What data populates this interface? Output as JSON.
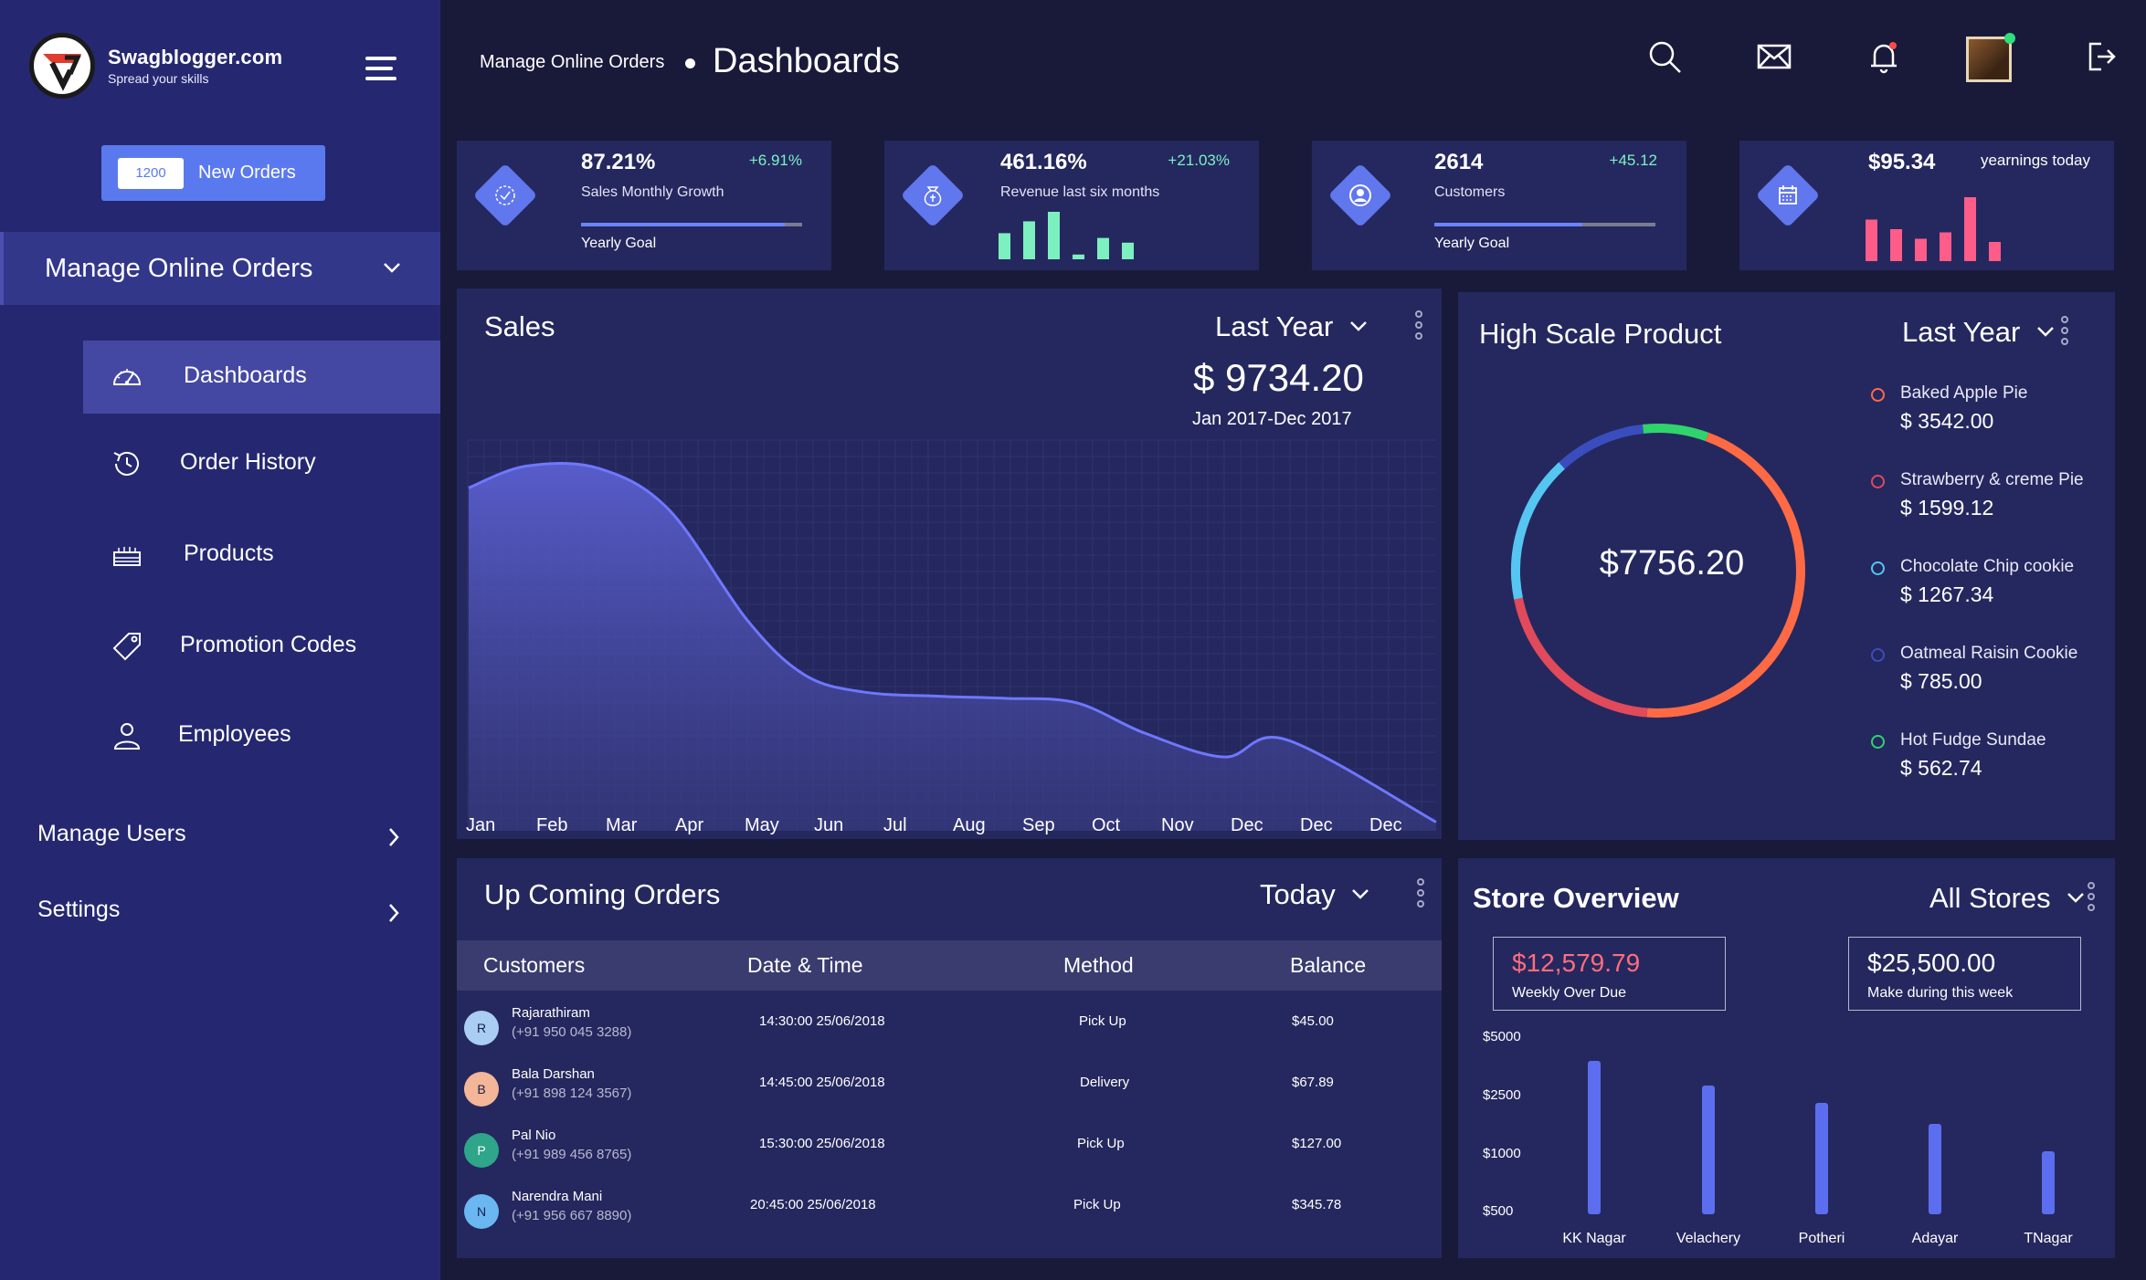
{
  "brand": {
    "title": "Swagblogger.com",
    "subtitle": "Spread your skills"
  },
  "sidebar": {
    "new_orders": {
      "count": "1200",
      "label": "New Orders"
    },
    "group": "Manage Online Orders",
    "items": [
      {
        "label": "Dashboards",
        "icon": "speedometer-icon"
      },
      {
        "label": "Order History",
        "icon": "history-icon"
      },
      {
        "label": "Products",
        "icon": "cake-icon"
      },
      {
        "label": "Promotion Codes",
        "icon": "tag-icon"
      },
      {
        "label": "Employees",
        "icon": "user-icon"
      }
    ],
    "links": [
      {
        "label": "Manage Users"
      },
      {
        "label": "Settings"
      }
    ]
  },
  "header": {
    "breadcrumb": "Manage Online Orders",
    "title": "Dashboards"
  },
  "stats": [
    {
      "value": "87.21%",
      "delta": "+6.91%",
      "label": "Sales Monthly Growth",
      "goal_label": "Yearly Goal",
      "goal_progress": 0.92,
      "icon": "badge-icon"
    },
    {
      "value": "461.16%",
      "delta": "+21.03%",
      "label": "Revenue last six months",
      "icon": "money-bag-icon",
      "bars": [
        0.55,
        0.8,
        1.0,
        0.1,
        0.45,
        0.35
      ]
    },
    {
      "value": "2614",
      "delta": "+45.12",
      "label": "Customers",
      "goal_label": "Yearly Goal",
      "goal_progress": 0.67,
      "icon": "user-circle-icon"
    },
    {
      "value": "$95.34",
      "delta": "yearnings today",
      "icon": "calendar-icon",
      "bars": [
        0.65,
        0.5,
        0.35,
        0.45,
        1.0,
        0.3
      ]
    }
  ],
  "sales": {
    "title": "Sales",
    "period": "Last Year",
    "amount": "$ 9734.20",
    "range": "Jan 2017-Dec 2017"
  },
  "high_scale": {
    "title": "High Scale Product",
    "period": "Last Year",
    "total": "$7756.20",
    "products": [
      {
        "name": "Baked Apple Pie",
        "value": "$ 3542.00",
        "color": "#ff6a45"
      },
      {
        "name": "Strawberry & creme Pie",
        "value": "$ 1599.12",
        "color": "#e04a5a"
      },
      {
        "name": "Chocolate Chip cookie",
        "value": "$ 1267.34",
        "color": "#55c6f2"
      },
      {
        "name": "Oatmeal Raisin Cookie",
        "value": "$ 785.00",
        "color": "#3a4dbf"
      },
      {
        "name": "Hot Fudge Sundae",
        "value": "$ 562.74",
        "color": "#2fd46c"
      }
    ]
  },
  "orders": {
    "title": "Up Coming Orders",
    "period": "Today",
    "columns": [
      "Customers",
      "Date & Time",
      "Method",
      "Balance"
    ],
    "rows": [
      {
        "initial": "R",
        "avatar_color": "#a9cdf3",
        "name": "Rajarathiram",
        "phone": "(+91 950 045 3288)",
        "datetime": "14:30:00 25/06/2018",
        "method": "Pick Up",
        "balance": "$45.00"
      },
      {
        "initial": "B",
        "avatar_color": "#f4b698",
        "name": "Bala Darshan",
        "phone": "(+91 898 124 3567)",
        "datetime": "14:45:00 25/06/2018",
        "method": "Delivery",
        "balance": "$67.89"
      },
      {
        "initial": "P",
        "avatar_color": "#2fa58a",
        "name": "Pal Nio",
        "phone": "(+91 989 456 8765)",
        "datetime": "15:30:00 25/06/2018",
        "method": "Pick Up",
        "balance": "$127.00"
      },
      {
        "initial": "N",
        "avatar_color": "#6ab7f2",
        "name": "Narendra Mani",
        "phone": "(+91 956 667 8890)",
        "datetime": "20:45:00 25/06/2018",
        "method": "Pick Up",
        "balance": "$345.78"
      }
    ]
  },
  "store": {
    "title": "Store Overview",
    "filter": "All Stores",
    "weekly_due": {
      "value": "$12,579.79",
      "label": "Weekly Over Due"
    },
    "week_made": {
      "value": "$25,500.00",
      "label": "Make during this week"
    }
  },
  "chart_data": [
    {
      "type": "area",
      "title": "Sales",
      "categories": [
        "Jan",
        "Feb",
        "Mar",
        "Apr",
        "May",
        "Jun",
        "Jul",
        "Aug",
        "Sep",
        "Oct",
        "Nov",
        "Dec",
        "Dec",
        "Dec"
      ],
      "values": [
        7900,
        8400,
        8350,
        7400,
        4850,
        3600,
        3200,
        3100,
        3050,
        2950,
        2250,
        1700,
        2100,
        200
      ],
      "ylim": [
        0,
        9000
      ]
    },
    {
      "type": "pie",
      "title": "High Scale Product",
      "categories": [
        "Baked Apple Pie",
        "Strawberry & creme Pie",
        "Chocolate Chip cookie",
        "Oatmeal Raisin Cookie",
        "Hot Fudge Sundae"
      ],
      "values": [
        3542.0,
        1599.12,
        1267.34,
        785.0,
        562.74
      ]
    },
    {
      "type": "bar",
      "title": "Store Overview",
      "categories": [
        "KK Nagar",
        "Velachery",
        "Potheri",
        "Adayar",
        "TNagar"
      ],
      "values": [
        4400,
        3700,
        3200,
        2600,
        1800
      ],
      "yticks": [
        "$5000",
        "$2500",
        "$1000",
        "$500"
      ],
      "ylim": [
        0,
        5500
      ]
    }
  ]
}
